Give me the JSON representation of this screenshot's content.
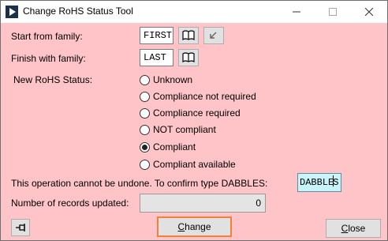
{
  "window": {
    "title": "Change RoHS Status Tool",
    "controls": {
      "minimize": "minimize-icon",
      "maximize": "maximize-icon",
      "close": "close-icon"
    }
  },
  "form": {
    "start_label": "Start from family:",
    "start_value": "FIRST",
    "finish_label": "Finish with family:",
    "finish_value": "LAST",
    "status_label": "New RoHS Status:",
    "status_options": [
      {
        "label": "Unknown",
        "checked": false
      },
      {
        "label": "Compliance not required",
        "checked": false
      },
      {
        "label": "Compliance required",
        "checked": false
      },
      {
        "label": "NOT compliant",
        "checked": false
      },
      {
        "label": "Compliant",
        "checked": true
      },
      {
        "label": "Compliant available",
        "checked": false
      }
    ],
    "confirm_label": "This operation cannot be undone.  To confirm type DABBLES:",
    "confirm_value_a": "DABBLE",
    "confirm_value_b": "S",
    "records_label": "Number of records updated:",
    "records_value": "0"
  },
  "buttons": {
    "change_prefix": "",
    "change_ul": "C",
    "change_rest": "hange",
    "close_ul": "C",
    "close_rest": "lose"
  },
  "icons": {
    "lookup": "book-icon",
    "first_arrow": "arrow-down-left-icon",
    "pin": "pin-icon"
  },
  "colors": {
    "background": "#fec4c8",
    "confirm_field": "#c8f4fb",
    "change_border": "#f0803c"
  }
}
